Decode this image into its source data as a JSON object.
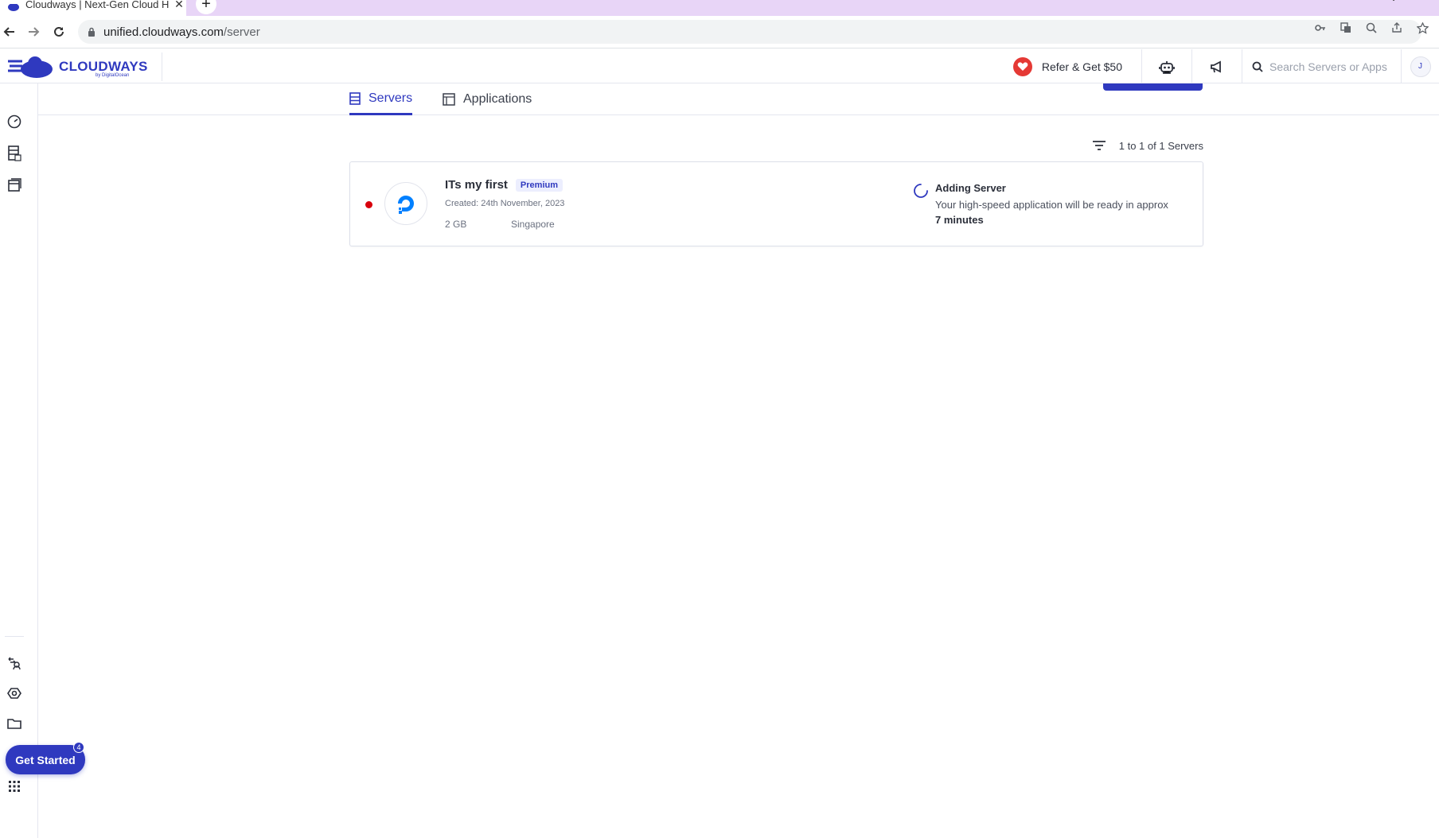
{
  "browser": {
    "tab_title": "Cloudways | Next-Gen Cloud H",
    "new_tab": "+",
    "url_host": "unified.cloudways.com",
    "url_path": "/server"
  },
  "header": {
    "brand": "CLOUDWAYS",
    "brand_sub": "by DigitalOcean",
    "refer_label": "Refer & Get $50",
    "search_placeholder": "Search Servers or Apps",
    "avatar_initial": "J"
  },
  "tabs": [
    {
      "label": "Servers",
      "active": true
    },
    {
      "label": "Applications",
      "active": false
    }
  ],
  "results": {
    "summary": "1 to 1 of 1 Servers"
  },
  "servers": [
    {
      "name": "ITs my first",
      "badge": "Premium",
      "created": "Created: 24th November, 2023",
      "size": "2 GB",
      "location": "Singapore",
      "status_color": "#d8000c",
      "provider_icon": "digitalocean-icon",
      "progress_title": "Adding Server",
      "progress_text": "Your high-speed application will be ready in approx",
      "progress_eta": "7 minutes"
    }
  ],
  "get_started": {
    "label": "Get Started",
    "count": "4"
  },
  "colors": {
    "brand": "#2f39bf",
    "status_offline": "#d8000c"
  }
}
